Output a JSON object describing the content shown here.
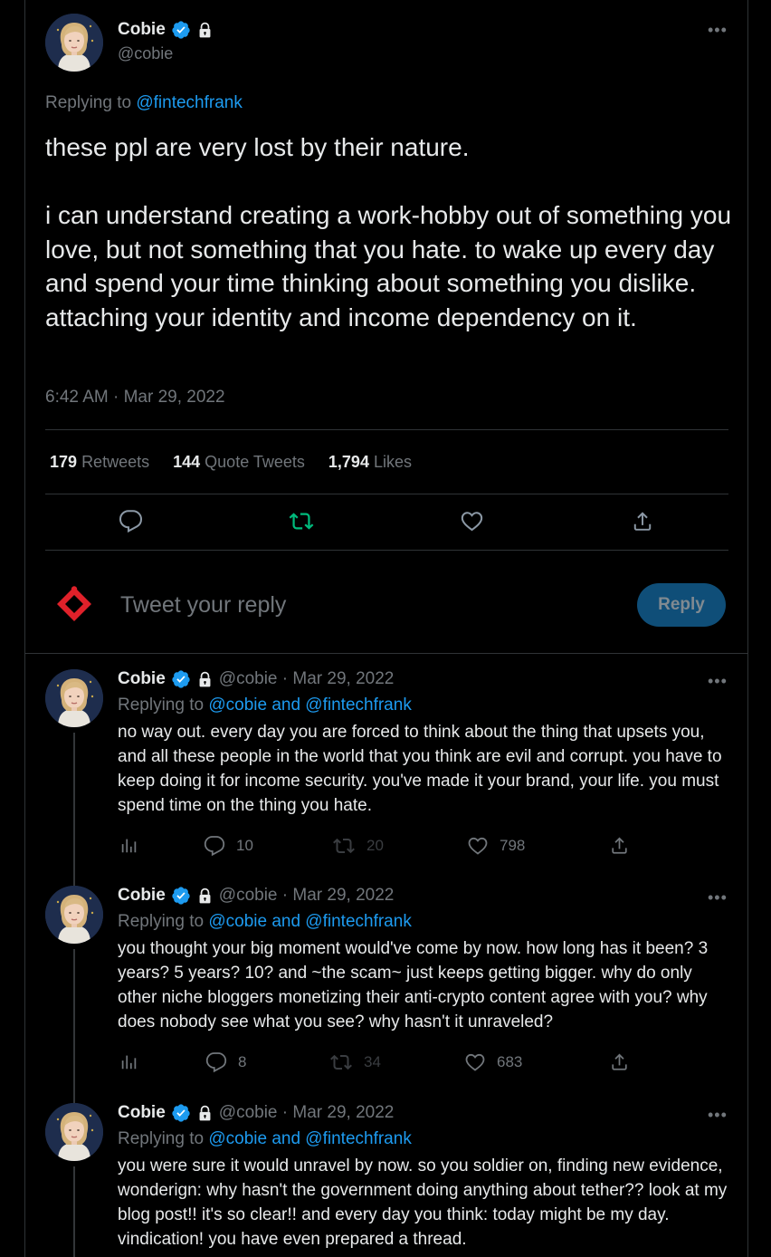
{
  "main_tweet": {
    "name": "Cobie",
    "handle": "@cobie",
    "replying_prefix": "Replying to",
    "replying_to": "@fintechfrank",
    "text": "these ppl are very lost by their nature.\n\ni can understand creating a work-hobby out of something you love, but not something that you hate. to wake up every day and spend your time thinking about something you dislike. attaching your identity and income dependency on it.",
    "timestamp": "6:42 AM · Mar 29, 2022",
    "stats": [
      {
        "count": "179",
        "label": "Retweets"
      },
      {
        "count": "144",
        "label": "Quote Tweets"
      },
      {
        "count": "1,794",
        "label": "Likes"
      }
    ]
  },
  "compose": {
    "placeholder": "Tweet your reply",
    "reply_button": "Reply"
  },
  "replies": [
    {
      "name": "Cobie",
      "meta": "@cobie · Mar 29, 2022",
      "replying_prefix": "Replying to",
      "replying_to": "@cobie and @fintechfrank",
      "text": "no way out. every day you are forced to think about the thing that upsets you, and all these people in the world that you think are evil and corrupt. you have to keep doing it for income security. you've made it your brand, your life. you must spend time on the thing you hate.",
      "replies": "10",
      "retweets": "20",
      "likes": "798"
    },
    {
      "name": "Cobie",
      "meta": "@cobie · Mar 29, 2022",
      "replying_prefix": "Replying to",
      "replying_to": "@cobie and @fintechfrank",
      "text": "you thought your big moment would've come by now. how long has it been? 3 years? 5 years? 10? and ~the scam~ just keeps getting bigger. why do only other niche bloggers monetizing their anti-crypto content agree with you? why does nobody see what you see? why hasn't it unraveled?",
      "replies": "8",
      "retweets": "34",
      "likes": "683"
    },
    {
      "name": "Cobie",
      "meta": "@cobie · Mar 29, 2022",
      "replying_prefix": "Replying to",
      "replying_to": "@cobie and @fintechfrank",
      "text": "you were sure it would unravel by now. so you soldier on, finding new evidence, wonderign: why hasn't the government doing anything about tether?? look at my blog post!! it's so clear!! and every day you think: today might be my day. vindication! you have even prepared a thread."
    }
  ],
  "colors": {
    "background": "#000000",
    "text": "#e7e9ea",
    "secondary": "#71767b",
    "link": "#1d9bf0",
    "retweet_active": "#00ba7c",
    "reply_button_bg": "#0f4e78"
  }
}
